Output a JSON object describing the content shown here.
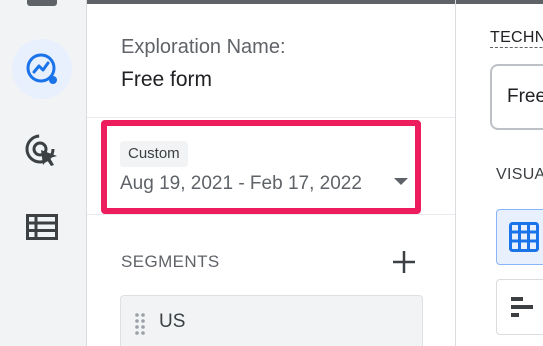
{
  "nav": {
    "items": [
      {
        "name": "explore",
        "icon": "explore-icon",
        "active": true
      },
      {
        "name": "advertising",
        "icon": "advertising-icon",
        "active": false
      },
      {
        "name": "configure",
        "icon": "list-table-icon",
        "active": false
      }
    ]
  },
  "variables": {
    "exploration_name_label": "Exploration Name:",
    "exploration_name_value": "Free form",
    "date": {
      "chip": "Custom",
      "range": "Aug 19, 2021 - Feb 17, 2022"
    },
    "segments": {
      "title": "SEGMENTS",
      "items": [
        "US"
      ]
    }
  },
  "tab_settings": {
    "technique_label": "TECHNIQUE",
    "technique_value": "Free form",
    "visualization_label": "VISUALIZATION"
  },
  "colors": {
    "highlight": "#ec1c5d",
    "accent": "#1a73e8",
    "rail_bg": "#f1f3f4"
  }
}
